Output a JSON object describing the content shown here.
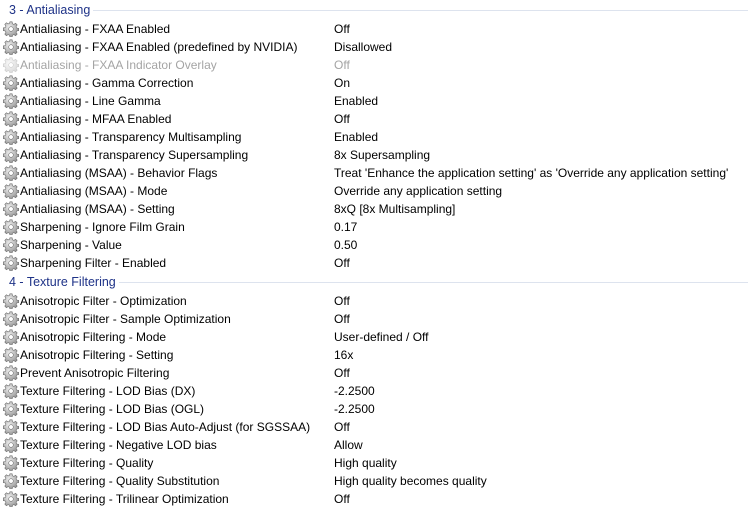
{
  "groups": [
    {
      "title": "3 - Antialiasing",
      "rows": [
        {
          "name": "Antialiasing - FXAA Enabled",
          "value": "Off"
        },
        {
          "name": "Antialiasing - FXAA Enabled (predefined by NVIDIA)",
          "value": "Disallowed"
        },
        {
          "name": "Antialiasing - FXAA Indicator Overlay",
          "value": "Off",
          "disabled": true
        },
        {
          "name": "Antialiasing - Gamma Correction",
          "value": "On"
        },
        {
          "name": "Antialiasing - Line Gamma",
          "value": "Enabled"
        },
        {
          "name": "Antialiasing - MFAA Enabled",
          "value": "Off"
        },
        {
          "name": "Antialiasing - Transparency Multisampling",
          "value": "Enabled"
        },
        {
          "name": "Antialiasing - Transparency Supersampling",
          "value": "8x Supersampling"
        },
        {
          "name": "Antialiasing (MSAA) - Behavior Flags",
          "value": "Treat 'Enhance the application setting' as 'Override any application setting'"
        },
        {
          "name": "Antialiasing (MSAA) - Mode",
          "value": "Override any application setting"
        },
        {
          "name": "Antialiasing (MSAA) - Setting",
          "value": "8xQ [8x Multisampling]"
        },
        {
          "name": "Sharpening - Ignore Film Grain",
          "value": "0.17"
        },
        {
          "name": "Sharpening - Value",
          "value": "0.50"
        },
        {
          "name": "Sharpening Filter - Enabled",
          "value": "Off"
        }
      ]
    },
    {
      "title": "4 - Texture Filtering",
      "rows": [
        {
          "name": "Anisotropic Filter - Optimization",
          "value": "Off"
        },
        {
          "name": "Anisotropic Filter - Sample Optimization",
          "value": "Off"
        },
        {
          "name": "Anisotropic Filtering - Mode",
          "value": "User-defined / Off"
        },
        {
          "name": "Anisotropic Filtering - Setting",
          "value": "16x"
        },
        {
          "name": "Prevent Anisotropic Filtering",
          "value": "Off"
        },
        {
          "name": "Texture Filtering - LOD Bias (DX)",
          "value": "-2.2500"
        },
        {
          "name": "Texture Filtering - LOD Bias (OGL)",
          "value": "-2.2500"
        },
        {
          "name": "Texture Filtering - LOD Bias Auto-Adjust (for SGSSAA)",
          "value": "Off"
        },
        {
          "name": "Texture Filtering - Negative LOD bias",
          "value": "Allow"
        },
        {
          "name": "Texture Filtering - Quality",
          "value": "High quality"
        },
        {
          "name": "Texture Filtering - Quality Substitution",
          "value": "High quality becomes quality"
        },
        {
          "name": "Texture Filtering - Trilinear Optimization",
          "value": "Off"
        }
      ]
    }
  ],
  "icons": {
    "setting": "gear-icon"
  },
  "colors": {
    "group_title": "#1e3287",
    "group_line": "#dde3ee",
    "disabled_text": "#a4a4a4"
  }
}
